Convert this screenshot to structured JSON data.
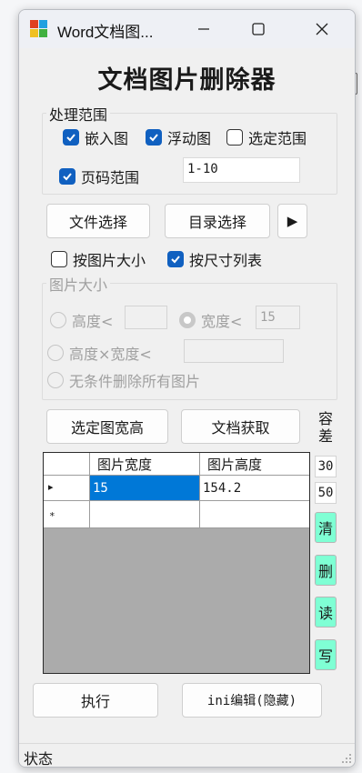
{
  "window": {
    "title": "Word文档图...",
    "controls": {
      "minimize": "minimize-icon",
      "maximize": "maximize-icon",
      "close": "close-icon"
    }
  },
  "main_title": "文档图片删除器",
  "scope_group": {
    "legend": "处理范围",
    "embedded": {
      "label": "嵌入图",
      "checked": true
    },
    "floating": {
      "label": "浮动图",
      "checked": true
    },
    "selection": {
      "label": "选定范围",
      "checked": false
    },
    "page_range": {
      "label": "页码范围",
      "checked": true,
      "value": "1-10"
    }
  },
  "buttons": {
    "file_select": "文件选择",
    "dir_select": "目录选择",
    "run_arrow": "▶",
    "select_wh": "选定图宽高",
    "doc_fetch": "文档获取",
    "execute": "执行",
    "ini_edit": "ini编辑(隐藏)"
  },
  "mode": {
    "by_size": {
      "label": "按图片大小",
      "checked": false
    },
    "by_list": {
      "label": "按尺寸列表",
      "checked": true
    }
  },
  "size_group": {
    "legend": "图片大小",
    "height_lt": {
      "label": "高度<",
      "value": ""
    },
    "width_lt": {
      "label": "宽度<",
      "value": "15",
      "checked": true
    },
    "area_lt": {
      "label": "高度×宽度<",
      "value": ""
    },
    "delete_all": {
      "label": "无条件删除所有图片"
    }
  },
  "tolerance": {
    "label": "容\n差",
    "width_tol": "30",
    "height_tol": "50"
  },
  "side_actions": [
    "清",
    "删",
    "读",
    "写"
  ],
  "grid": {
    "columns": [
      "图片宽度",
      "图片高度"
    ],
    "rows": [
      {
        "width": "15",
        "height": "154.2"
      }
    ],
    "new_row_marker": "*",
    "current_row_marker": "▸"
  },
  "status": "状态",
  "colors": {
    "accent": "#1060c0",
    "selection": "#0078d7",
    "side_button": "#7fffd4"
  }
}
